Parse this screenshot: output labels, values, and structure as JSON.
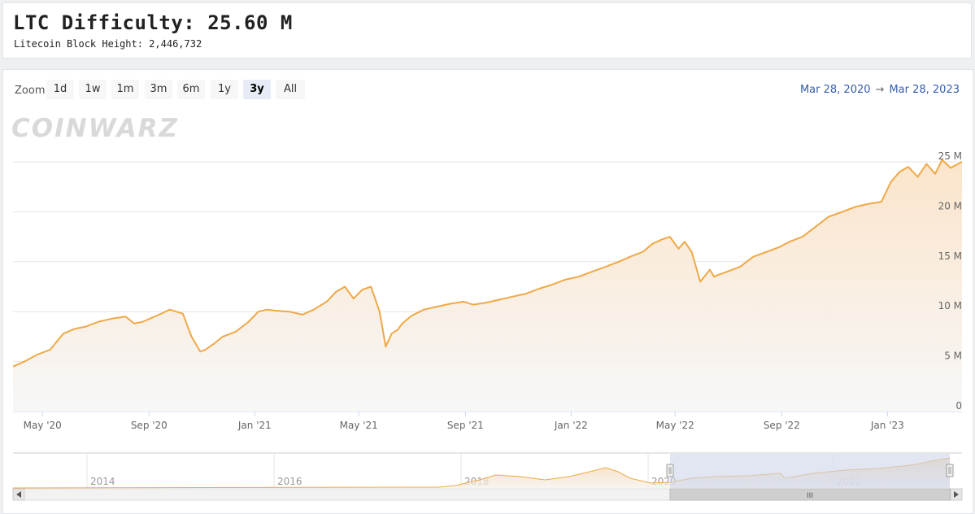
{
  "header": {
    "title": "LTC Difficulty: 25.60 M",
    "subtitle": "Litecoin Block Height: 2,446,732"
  },
  "watermark": "COINWARZ",
  "zoom": {
    "label": "Zoom",
    "buttons": [
      "1d",
      "1w",
      "1m",
      "3m",
      "6m",
      "1y",
      "3y",
      "All"
    ],
    "active": "3y"
  },
  "date_range": {
    "from": "Mar 28, 2020",
    "arrow": "→",
    "to": "Mar 28, 2023"
  },
  "navigator": {
    "year_labels": [
      "2014",
      "2016",
      "2018",
      "2020",
      "2022"
    ],
    "scroll_grip": "III",
    "left_arrow_icon": "triangle-left",
    "right_arrow_icon": "triangle-right"
  },
  "colors": {
    "line": "#f0a847",
    "fill": "#fbe6cf",
    "grid": "#e6e6e6",
    "accent": "#335cad",
    "navigator_mask": "#cdd5ea"
  },
  "chart_data": {
    "type": "area",
    "title": "",
    "xlabel": "",
    "ylabel": "",
    "x_ticks": [
      "May '20",
      "Sep '20",
      "Jan '21",
      "May '21",
      "Sep '21",
      "Jan '22",
      "May '22",
      "Sep '22",
      "Jan '23"
    ],
    "y_ticks": [
      "0",
      "5 M",
      "10 M",
      "15 M",
      "20 M",
      "25 M"
    ],
    "ylim": [
      0,
      25
    ],
    "y_unit": "M",
    "grid": true,
    "x": [
      "2020-03-28",
      "2020-04-10",
      "2020-04-25",
      "2020-05-10",
      "2020-05-25",
      "2020-06-08",
      "2020-06-20",
      "2020-07-05",
      "2020-07-20",
      "2020-08-05",
      "2020-08-15",
      "2020-08-25",
      "2020-09-10",
      "2020-09-25",
      "2020-10-10",
      "2020-10-20",
      "2020-10-30",
      "2020-11-05",
      "2020-11-15",
      "2020-11-25",
      "2020-12-10",
      "2020-12-25",
      "2021-01-05",
      "2021-01-15",
      "2021-01-25",
      "2021-02-10",
      "2021-02-25",
      "2021-03-10",
      "2021-03-25",
      "2021-04-05",
      "2021-04-15",
      "2021-04-25",
      "2021-05-05",
      "2021-05-15",
      "2021-05-25",
      "2021-06-01",
      "2021-06-08",
      "2021-06-15",
      "2021-06-20",
      "2021-07-01",
      "2021-07-15",
      "2021-07-30",
      "2021-08-15",
      "2021-08-30",
      "2021-09-10",
      "2021-09-25",
      "2021-10-10",
      "2021-10-25",
      "2021-11-10",
      "2021-11-25",
      "2021-12-10",
      "2021-12-25",
      "2022-01-10",
      "2022-01-25",
      "2022-02-10",
      "2022-02-25",
      "2022-03-10",
      "2022-03-25",
      "2022-04-05",
      "2022-04-15",
      "2022-04-25",
      "2022-05-05",
      "2022-05-12",
      "2022-05-20",
      "2022-05-30",
      "2022-06-10",
      "2022-06-15",
      "2022-06-20",
      "2022-06-30",
      "2022-07-15",
      "2022-07-30",
      "2022-08-15",
      "2022-08-30",
      "2022-09-10",
      "2022-09-25",
      "2022-10-10",
      "2022-10-25",
      "2022-11-10",
      "2022-11-25",
      "2022-12-10",
      "2022-12-25",
      "2023-01-05",
      "2023-01-15",
      "2023-01-25",
      "2023-02-05",
      "2023-02-15",
      "2023-02-25",
      "2023-03-05",
      "2023-03-15",
      "2023-03-28"
    ],
    "values": [
      4.5,
      5.0,
      5.7,
      6.2,
      7.8,
      8.3,
      8.5,
      9.0,
      9.3,
      9.5,
      8.8,
      9.0,
      9.6,
      10.2,
      9.8,
      7.5,
      6.0,
      6.2,
      6.8,
      7.5,
      8.0,
      9.0,
      10.0,
      10.2,
      10.1,
      10.0,
      9.7,
      10.2,
      11.0,
      12.0,
      12.5,
      11.3,
      12.2,
      12.5,
      10.0,
      6.5,
      7.8,
      8.2,
      8.8,
      9.6,
      10.2,
      10.5,
      10.8,
      11.0,
      10.7,
      10.9,
      11.2,
      11.5,
      11.8,
      12.3,
      12.7,
      13.2,
      13.5,
      14.0,
      14.5,
      15.0,
      15.5,
      16.0,
      16.8,
      17.2,
      17.5,
      16.3,
      17.0,
      16.0,
      13.0,
      14.2,
      13.5,
      13.7,
      14.0,
      14.5,
      15.5,
      16.0,
      16.5,
      17.0,
      17.5,
      18.5,
      19.5,
      20.0,
      20.5,
      20.8,
      21.0,
      23.0,
      24.0,
      24.5,
      23.5,
      24.8,
      23.8,
      25.2,
      24.4,
      25.0
    ]
  }
}
